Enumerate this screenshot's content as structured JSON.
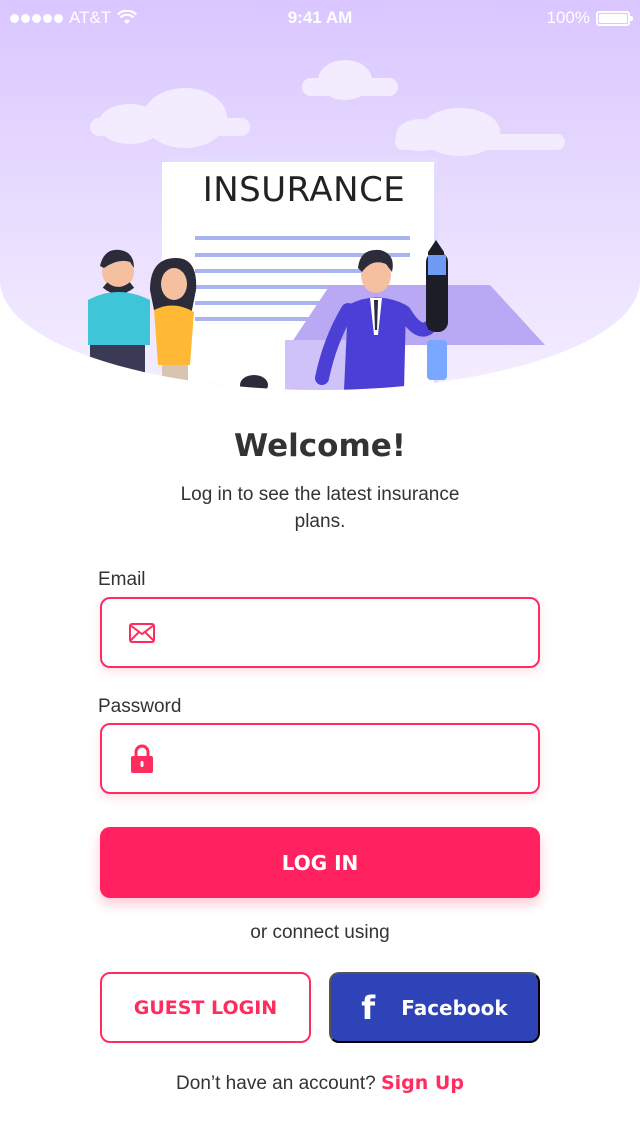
{
  "status_bar": {
    "carrier": "AT&T",
    "time": "9:41 AM",
    "battery": "100%"
  },
  "hero": {
    "document_title": "INSURANCE"
  },
  "welcome": {
    "title": "Welcome!",
    "subtitle": "Log in to see the latest insurance plans."
  },
  "form": {
    "email_label": "Email",
    "email_value": "",
    "password_label": "Password",
    "password_value": "",
    "email_icon": "mail-icon",
    "password_icon": "lock-icon"
  },
  "actions": {
    "login_label": "LOG IN",
    "connect_text": "or connect using",
    "guest_label": "GUEST LOGIN",
    "facebook_label": "Facebook",
    "facebook_icon": "facebook-icon"
  },
  "signup": {
    "prompt": "Don’t have an account?",
    "link": "Sign Up"
  },
  "colors": {
    "accent": "#ff2160",
    "facebook": "#2f43b8",
    "hero_bg": "#d9c6ff"
  }
}
